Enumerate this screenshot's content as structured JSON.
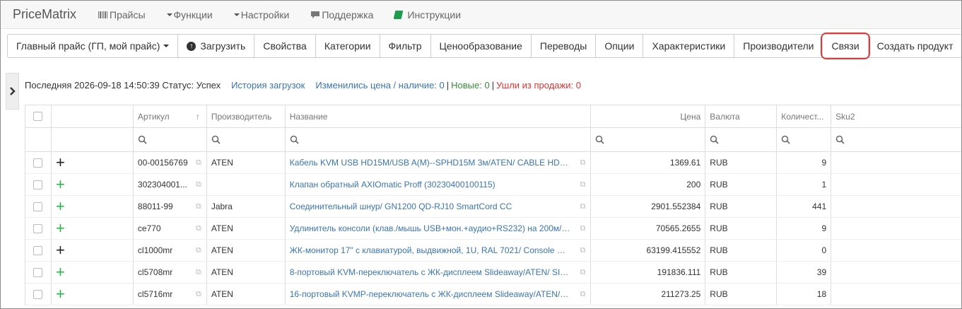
{
  "navbar": {
    "brand": "PriceMatrix",
    "items": [
      {
        "label": "Прайсы",
        "icon": "barcode-icon"
      },
      {
        "label": "Функции",
        "icon": "caret-down-icon"
      },
      {
        "label": "Настройки",
        "icon": "caret-down-icon"
      },
      {
        "label": "Поддержка",
        "icon": "chat-bubble-icon"
      },
      {
        "label": "Инструкции",
        "icon": "book-icon"
      }
    ]
  },
  "toolbar": {
    "price_select": "Главный прайс (ГП, мой прайс)",
    "upload": "Загрузить",
    "properties": "Свойства",
    "categories": "Категории",
    "filter": "Фильтр",
    "pricing": "Ценообразование",
    "translations": "Переводы",
    "options": "Опции",
    "characteristics": "Характеристики",
    "manufacturers": "Производители",
    "links": "Связи",
    "create_product": "Создать продукт",
    "highlight_color": "#e03a3a"
  },
  "status": {
    "last_label": "Последняя 2026-09-18 14:50:39 Статус: Успех",
    "history": "История загрузок",
    "changed": "Изменились цена / наличие: 0",
    "sep1": "|",
    "new": "Новые: 0",
    "sep2": "|",
    "gone": "Ушли из продажи: 0"
  },
  "table": {
    "columns": {
      "article": "Артикул",
      "manufacturer": "Производитель",
      "name": "Название",
      "price": "Цена",
      "currency": "Валюта",
      "quantity": "Количест...",
      "sku2": "Sku2"
    },
    "sort_arrow": "↑",
    "rows": [
      {
        "plus": "dark",
        "article": "00-00156769",
        "manufacturer": "ATEN",
        "name": "Кабель KVM USB HD15M/USB A(M)--SPHD15M 3м/ATEN/ CABLE HD15...",
        "price": "1369.61",
        "currency": "RUB",
        "quantity": "9"
      },
      {
        "plus": "green",
        "article": "302304001...",
        "manufacturer": "",
        "name": "Клапан обратный AXIOmatic Proff (30230400100115)",
        "price": "200",
        "currency": "RUB",
        "quantity": "1"
      },
      {
        "plus": "green",
        "article": "88011-99",
        "manufacturer": "Jabra",
        "name": "Соединительный шнур/ GN1200 QD-RJ10 SmartCord CC",
        "price": "2901.552384",
        "currency": "RUB",
        "quantity": "441"
      },
      {
        "plus": "green",
        "article": "ce770",
        "manufacturer": "ATEN",
        "name": "Удлинитель консоли (клав./мышь USB+мон.+аудио+RS232) на 200м/ ...",
        "price": "70565.2655",
        "currency": "RUB",
        "quantity": "9"
      },
      {
        "plus": "dark",
        "article": "cl1000mr",
        "manufacturer": "ATEN",
        "name": "ЖК-монитор 17\" с клавиатурой, выдвижной, 1U, RAL 7021/ Console wit...",
        "price": "63199.415552",
        "currency": "RUB",
        "quantity": "0"
      },
      {
        "plus": "green",
        "article": "cl5708mr",
        "manufacturer": "ATEN",
        "name": "8-портовый KVM-переключатель с ЖК-дисплеем Slideaway/ATEN/ SIN...",
        "price": "191836.111",
        "currency": "RUB",
        "quantity": "39"
      },
      {
        "plus": "green",
        "article": "cl5716mr",
        "manufacturer": "ATEN",
        "name": "16-портовый KVMP-переключатель с ЖК-дисплеем Slideaway/ATEN/ S...",
        "price": "211273.25",
        "currency": "RUB",
        "quantity": "18"
      }
    ]
  }
}
